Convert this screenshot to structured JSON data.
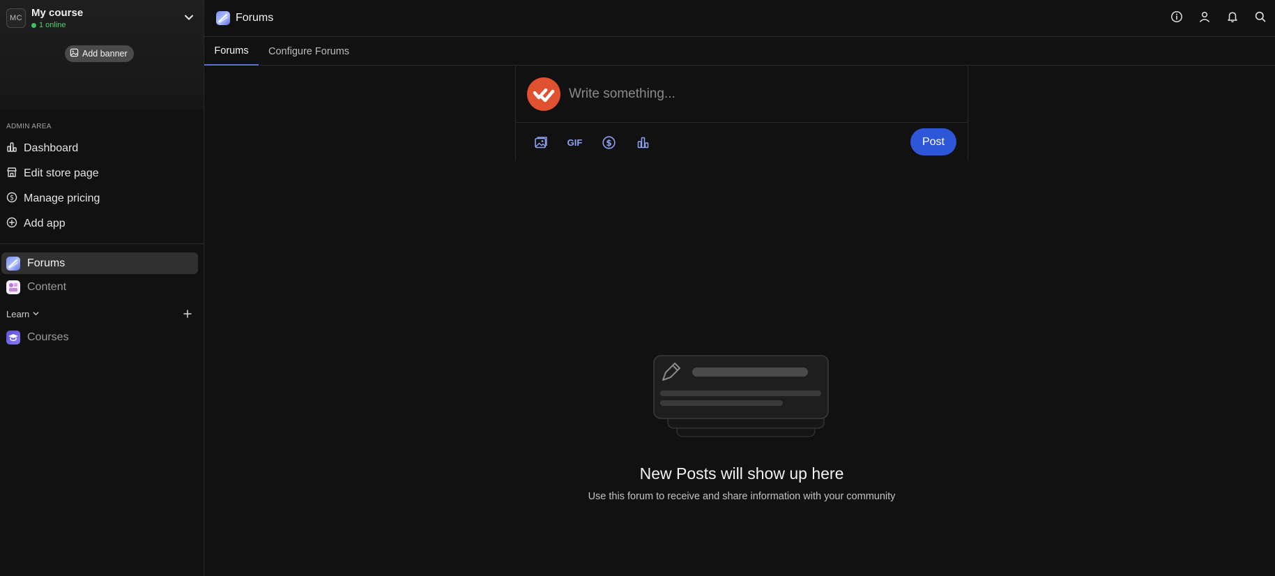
{
  "course": {
    "avatar_initials": "MC",
    "name": "My course",
    "online": "1 online",
    "add_banner": "Add banner"
  },
  "sidebar": {
    "admin_label": "ADMIN AREA",
    "admin_items": [
      {
        "label": "Dashboard",
        "icon": "bar-chart-icon"
      },
      {
        "label": "Edit store page",
        "icon": "store-icon"
      },
      {
        "label": "Manage pricing",
        "icon": "dollar-circle-icon"
      },
      {
        "label": "Add app",
        "icon": "plus-circle-icon"
      }
    ],
    "apps": [
      {
        "label": "Forums",
        "icon": "forums-app-icon",
        "active": true
      },
      {
        "label": "Content",
        "icon": "content-app-icon",
        "active": false
      }
    ],
    "learn_label": "Learn",
    "learn_items": [
      {
        "label": "Courses",
        "icon": "courses-app-icon"
      }
    ]
  },
  "topbar": {
    "title": "Forums",
    "icons": [
      "info-icon",
      "user-icon",
      "bell-icon",
      "search-icon"
    ]
  },
  "tabs": [
    {
      "label": "Forums",
      "active": true
    },
    {
      "label": "Configure Forums",
      "active": false
    }
  ],
  "composer": {
    "placeholder": "Write something...",
    "gif_label": "GIF",
    "post_label": "Post",
    "tools": [
      "image-icon",
      "gif-icon",
      "dollar-circle-icon",
      "poll-icon"
    ]
  },
  "empty_state": {
    "title": "New Posts will show up here",
    "subtitle": "Use this forum to receive and share information with your community"
  },
  "colors": {
    "background": "#111111",
    "accent": "#2d56d8",
    "tab_underline": "#5a6fd6",
    "online": "#4fcf6f",
    "avatar": "#e0512f"
  }
}
